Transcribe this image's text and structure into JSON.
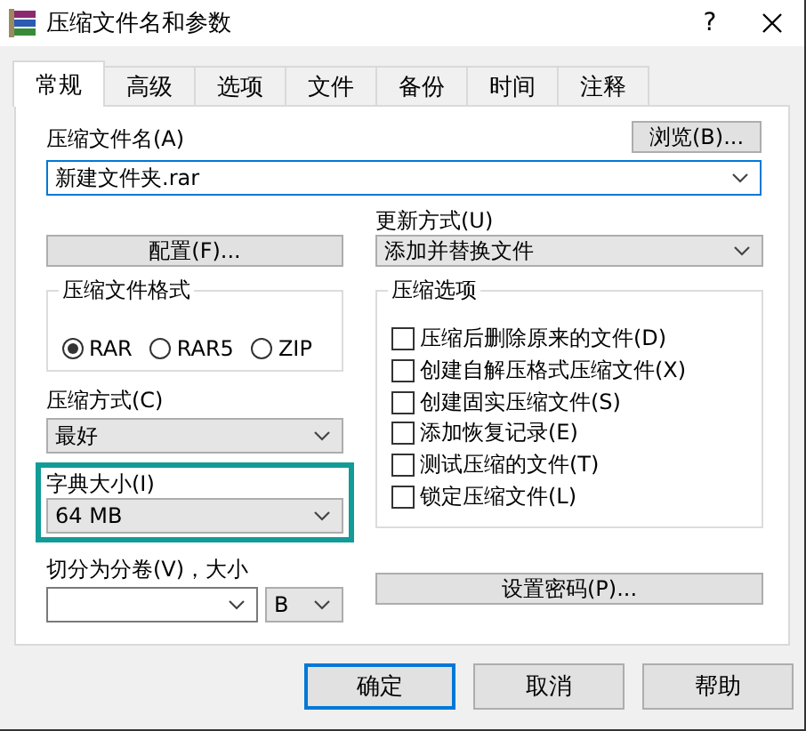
{
  "window": {
    "title": "压缩文件名和参数",
    "help": "?"
  },
  "tabs": [
    {
      "label": "常规",
      "selected": true
    },
    {
      "label": "高级",
      "selected": false
    },
    {
      "label": "选项",
      "selected": false
    },
    {
      "label": "文件",
      "selected": false
    },
    {
      "label": "备份",
      "selected": false
    },
    {
      "label": "时间",
      "selected": false
    },
    {
      "label": "注释",
      "selected": false
    }
  ],
  "archive_name": {
    "label": "压缩文件名(A)",
    "value": "新建文件夹.rar",
    "browse_button": "浏览(B)..."
  },
  "profiles_button": "配置(F)...",
  "update_mode": {
    "label": "更新方式(U)",
    "value": "添加并替换文件"
  },
  "archive_format": {
    "label": "压缩文件格式",
    "options": [
      {
        "label": "RAR",
        "selected": true
      },
      {
        "label": "RAR5",
        "selected": false
      },
      {
        "label": "ZIP",
        "selected": false
      }
    ]
  },
  "compression_method": {
    "label": "压缩方式(C)",
    "value": "最好"
  },
  "dictionary_size": {
    "label": "字典大小(I)",
    "value": "64 MB",
    "highlighted": true
  },
  "split_volumes": {
    "label": "切分为分卷(V)，大小",
    "unit": "B"
  },
  "archiving_options": {
    "label": "压缩选项",
    "items": [
      {
        "label": "压缩后删除原来的文件(D)",
        "checked": false
      },
      {
        "label": "创建自解压格式压缩文件(X)",
        "checked": false
      },
      {
        "label": "创建固实压缩文件(S)",
        "checked": false
      },
      {
        "label": "添加恢复记录(E)",
        "checked": false
      },
      {
        "label": "测试压缩的文件(T)",
        "checked": false
      },
      {
        "label": "锁定压缩文件(L)",
        "checked": false
      }
    ]
  },
  "password_button": "设置密码(P)...",
  "buttons": [
    {
      "label": "确定",
      "default": true
    },
    {
      "label": "取消",
      "default": false
    },
    {
      "label": "帮助",
      "default": false
    }
  ]
}
